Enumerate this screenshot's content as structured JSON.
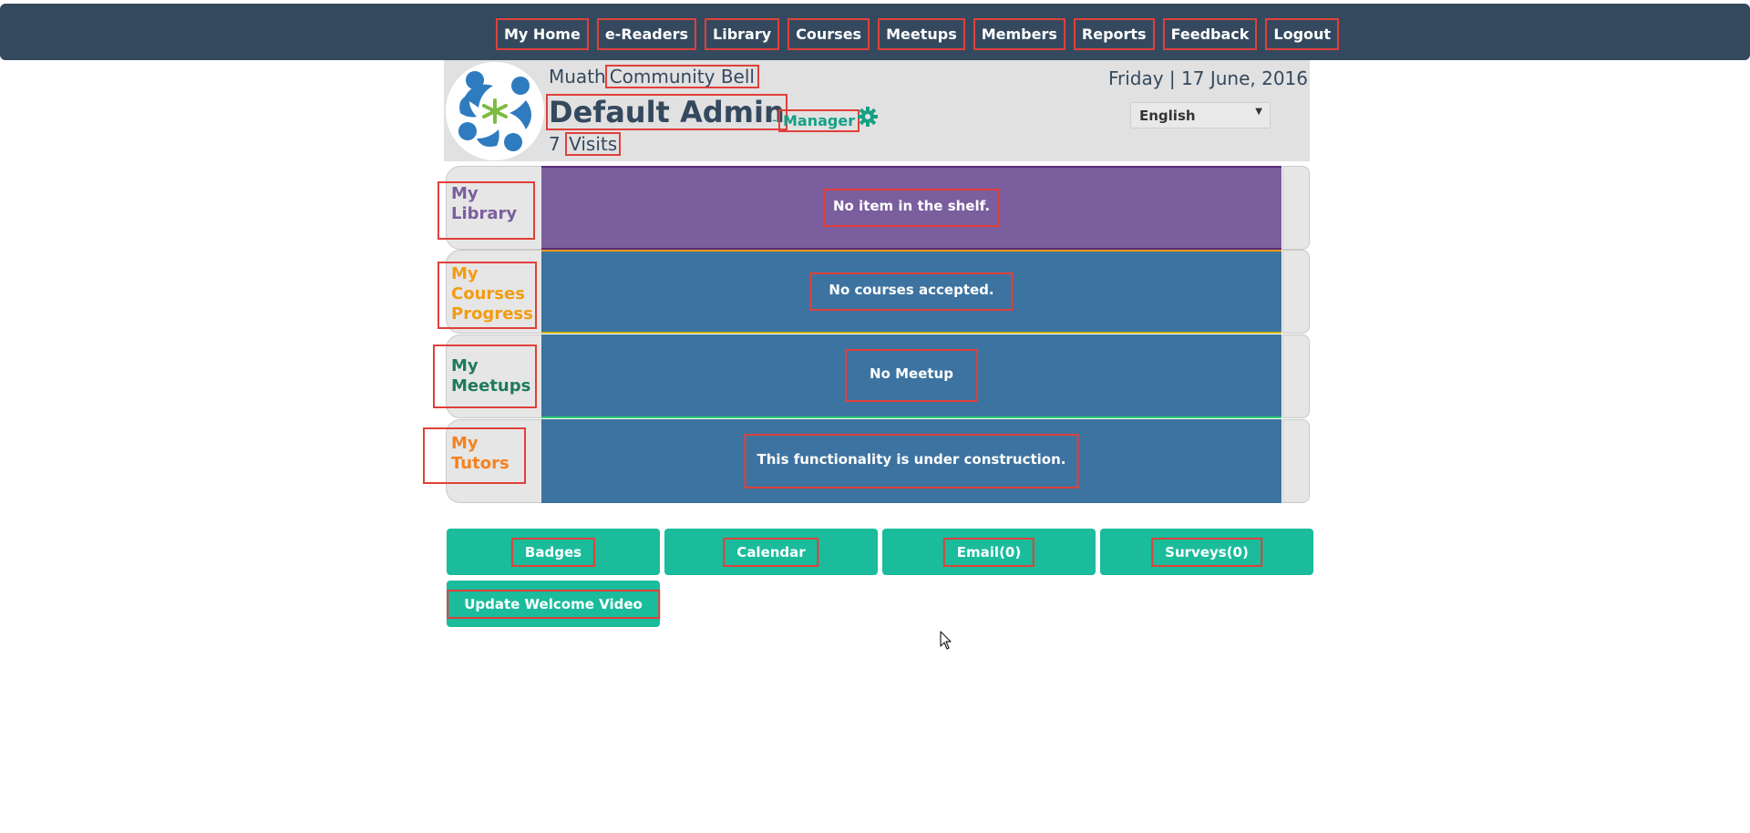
{
  "nav": {
    "items": [
      "My Home",
      "e-Readers",
      "Library",
      "Courses",
      "Meetups",
      "Members",
      "Reports",
      "Feedback",
      "Logout"
    ]
  },
  "header": {
    "community_prefix": "Muath",
    "community_name": "Community Bell",
    "user_name": "Default Admin",
    "separator": "-",
    "role": "Manager",
    "visits_count": "7",
    "visits_label": "Visits",
    "date": "Friday | 17 June, 2016",
    "language": "English"
  },
  "rows": [
    {
      "label_lines": [
        "My",
        "Library"
      ],
      "label_color": "#7b5e9e",
      "panel_color": "#7b5e9e",
      "message": "No item in the shelf."
    },
    {
      "label_lines": [
        "My",
        "Courses",
        "Progress"
      ],
      "label_color": "#f39c12",
      "panel_color": "#3d73a0",
      "message": "No courses accepted."
    },
    {
      "label_lines": [
        "My",
        "Meetups"
      ],
      "label_color": "#1f7a5a",
      "panel_color": "#3d73a0",
      "message": "No Meetup"
    },
    {
      "label_lines": [
        "My",
        "Tutors"
      ],
      "label_color": "#f58220",
      "panel_color": "#3d73a0",
      "message": "This functionality is under construction."
    }
  ],
  "buttons": {
    "badges": "Badges",
    "calendar": "Calendar",
    "email": "Email(0)",
    "surveys": "Surveys(0)",
    "welcome_video": "Update Welcome Video"
  },
  "colors": {
    "navbar": "#34495e",
    "accent": "#1abc9c",
    "library_purple": "#7b5e9e",
    "panel_blue": "#3d73a0"
  },
  "icons": {
    "settings": "gear-icon",
    "logo": "community-logo",
    "language_caret": "caret-down-icon"
  }
}
